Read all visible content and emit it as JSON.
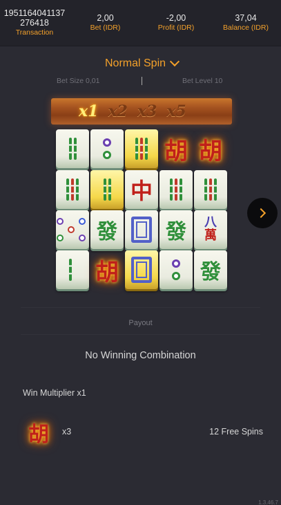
{
  "header": {
    "transaction_id_line1": "1951164041137",
    "transaction_id_line2": "276418",
    "transaction_label": "Transaction",
    "bet_value": "2,00",
    "bet_label": "Bet (IDR)",
    "profit_value": "-2,00",
    "profit_label": "Profit (IDR)",
    "balance_value": "37,04",
    "balance_label": "Balance (IDR)"
  },
  "spin_type": {
    "label": "Normal Spin"
  },
  "bet_info": {
    "bet_size": "Bet Size 0,01",
    "bet_level": "Bet Level 10"
  },
  "multipliers": {
    "items": [
      "x1",
      "x2",
      "x3",
      "x5"
    ],
    "active": "x1"
  },
  "reels": {
    "columns": [
      [
        "bamboo-2",
        "bamboo-3",
        "circles-5",
        "bamboo-2"
      ],
      [
        "circles-2",
        "bamboo-2-gold",
        "green-dragon",
        "wild-hu"
      ],
      [
        "bamboo-3-gold",
        "red-dragon",
        "white-dragon",
        "white-dragon-gold"
      ],
      [
        "wild-hu",
        "bamboo-3",
        "green-dragon",
        "circles-2"
      ],
      [
        "wild-hu",
        "bamboo-3",
        "character-8",
        "green-dragon"
      ]
    ],
    "glyphs": {
      "hu": "胡",
      "fa": "發",
      "zhong": "中",
      "eight": "八",
      "wan": "萬"
    }
  },
  "payout": {
    "label": "Payout",
    "result": "No Winning Combination",
    "win_multiplier": "Win Multiplier x1",
    "scatter_count": "x3",
    "scatter_reward": "12 Free Spins"
  },
  "version": "1.3.46.7",
  "colors": {
    "accent": "#f4a12a",
    "background": "#2b2b33",
    "header_bg": "#23232a"
  }
}
